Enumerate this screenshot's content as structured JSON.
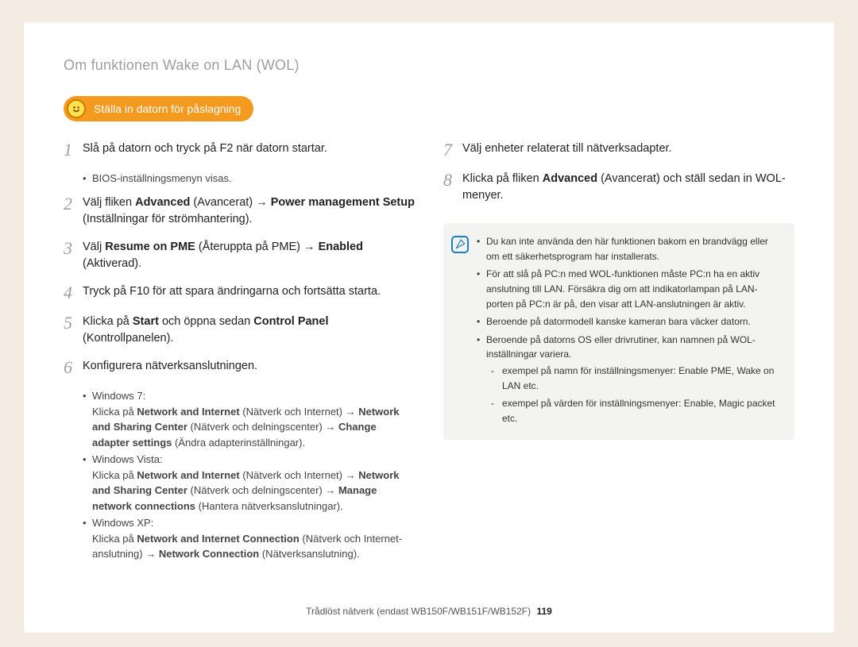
{
  "heading": "Om funktionen Wake on LAN (WOL)",
  "badge": "Ställa in datorn för påslagning",
  "left": {
    "s1": "Slå på datorn och tryck på F2 när datorn startar.",
    "s1sub": "BIOS-inställningsmenyn visas.",
    "s2_a": "Välj fliken ",
    "s2_b": "Advanced",
    "s2_c": " (Avancerat) → ",
    "s2_d": "Power management Setup",
    "s2_e": " (Inställningar för strömhantering).",
    "s3_a": "Välj ",
    "s3_b": "Resume on PME",
    "s3_c": " (Återuppta på PME) → ",
    "s3_d": "Enabled",
    "s3_e": " (Aktiverad).",
    "s4": "Tryck på F10 för att spara ändringarna och fortsätta starta.",
    "s5_a": "Klicka på ",
    "s5_b": "Start",
    "s5_c": " och öppna sedan ",
    "s5_d": "Control Panel",
    "s5_e": " (Kontrollpanelen).",
    "s6": "Konfigurera nätverksanslutningen.",
    "w7_title": "Windows 7:",
    "w7_a": "Klicka på ",
    "w7_b": "Network and Internet",
    "w7_c": " (Nätverk och Internet) → ",
    "w7_d": "Network and Sharing Center",
    "w7_e": " (Nätverk och delningscenter) → ",
    "w7_f": "Change adapter settings",
    "w7_g": " (Ändra adapterinställningar).",
    "wv_title": "Windows Vista:",
    "wv_a": "Klicka på ",
    "wv_b": "Network and Internet",
    "wv_c": " (Nätverk och Internet) → ",
    "wv_d": "Network and Sharing Center",
    "wv_e": " (Nätverk och delningscenter) → ",
    "wv_f": "Manage network connections",
    "wv_g": " (Hantera nätverksanslutningar).",
    "wx_title": "Windows XP:",
    "wx_a": "Klicka på ",
    "wx_b": "Network and Internet Connection",
    "wx_c": " (Nätverk och Internet-anslutning) → ",
    "wx_d": "Network Connection",
    "wx_e": " (Nätverksanslutning)."
  },
  "right": {
    "s7": "Välj enheter relaterat till nätverksadapter.",
    "s8_a": "Klicka på fliken ",
    "s8_b": "Advanced",
    "s8_c": " (Avancerat) och ställ sedan in WOL-menyer."
  },
  "notes": {
    "n1": "Du kan inte använda den här funktionen bakom en brandvägg eller om ett säkerhetsprogram har installerats.",
    "n2": "För att slå på PC:n med WOL-funktionen måste PC:n ha en aktiv anslutning till LAN. Försäkra dig om att indikatorlampan på LAN-porten på PC:n är på, den visar att LAN-anslutningen är aktiv.",
    "n3": "Beroende på datormodell kanske kameran bara väcker datorn.",
    "n4": "Beroende på datorns OS eller drivrutiner, kan namnen på WOL-inställningar variera.",
    "n4a": "exempel på namn för inställningsmenyer: Enable PME, Wake on LAN etc.",
    "n4b": "exempel på värden för inställningsmenyer: Enable, Magic packet etc."
  },
  "footer_text": "Trådlöst nätverk (endast WB150F/WB151F/WB152F)",
  "page_number": "119"
}
